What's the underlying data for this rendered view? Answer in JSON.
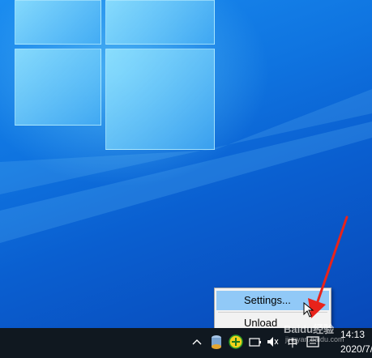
{
  "context_menu": {
    "items": [
      {
        "label": "Settings...",
        "highlighted": true
      },
      {
        "label": "Unload",
        "highlighted": false
      }
    ]
  },
  "taskbar": {
    "clock_time": "14:13",
    "clock_date": "2020/7/",
    "tray_icons": [
      "chevron-up-icon",
      "database-icon",
      "plus-circle-icon",
      "ime-icon",
      "battery-icon",
      "volume-icon",
      "chinese-input-icon",
      "keyboard-icon"
    ],
    "ime_label": "中",
    "accent_color": "#91c9f7"
  },
  "watermark": {
    "text": "Baidu经验",
    "sub": "jingyan.baidu.com"
  },
  "colors": {
    "desktop": "#0f74e0",
    "taskbar": "#101820",
    "arrow": "#e8231b"
  }
}
